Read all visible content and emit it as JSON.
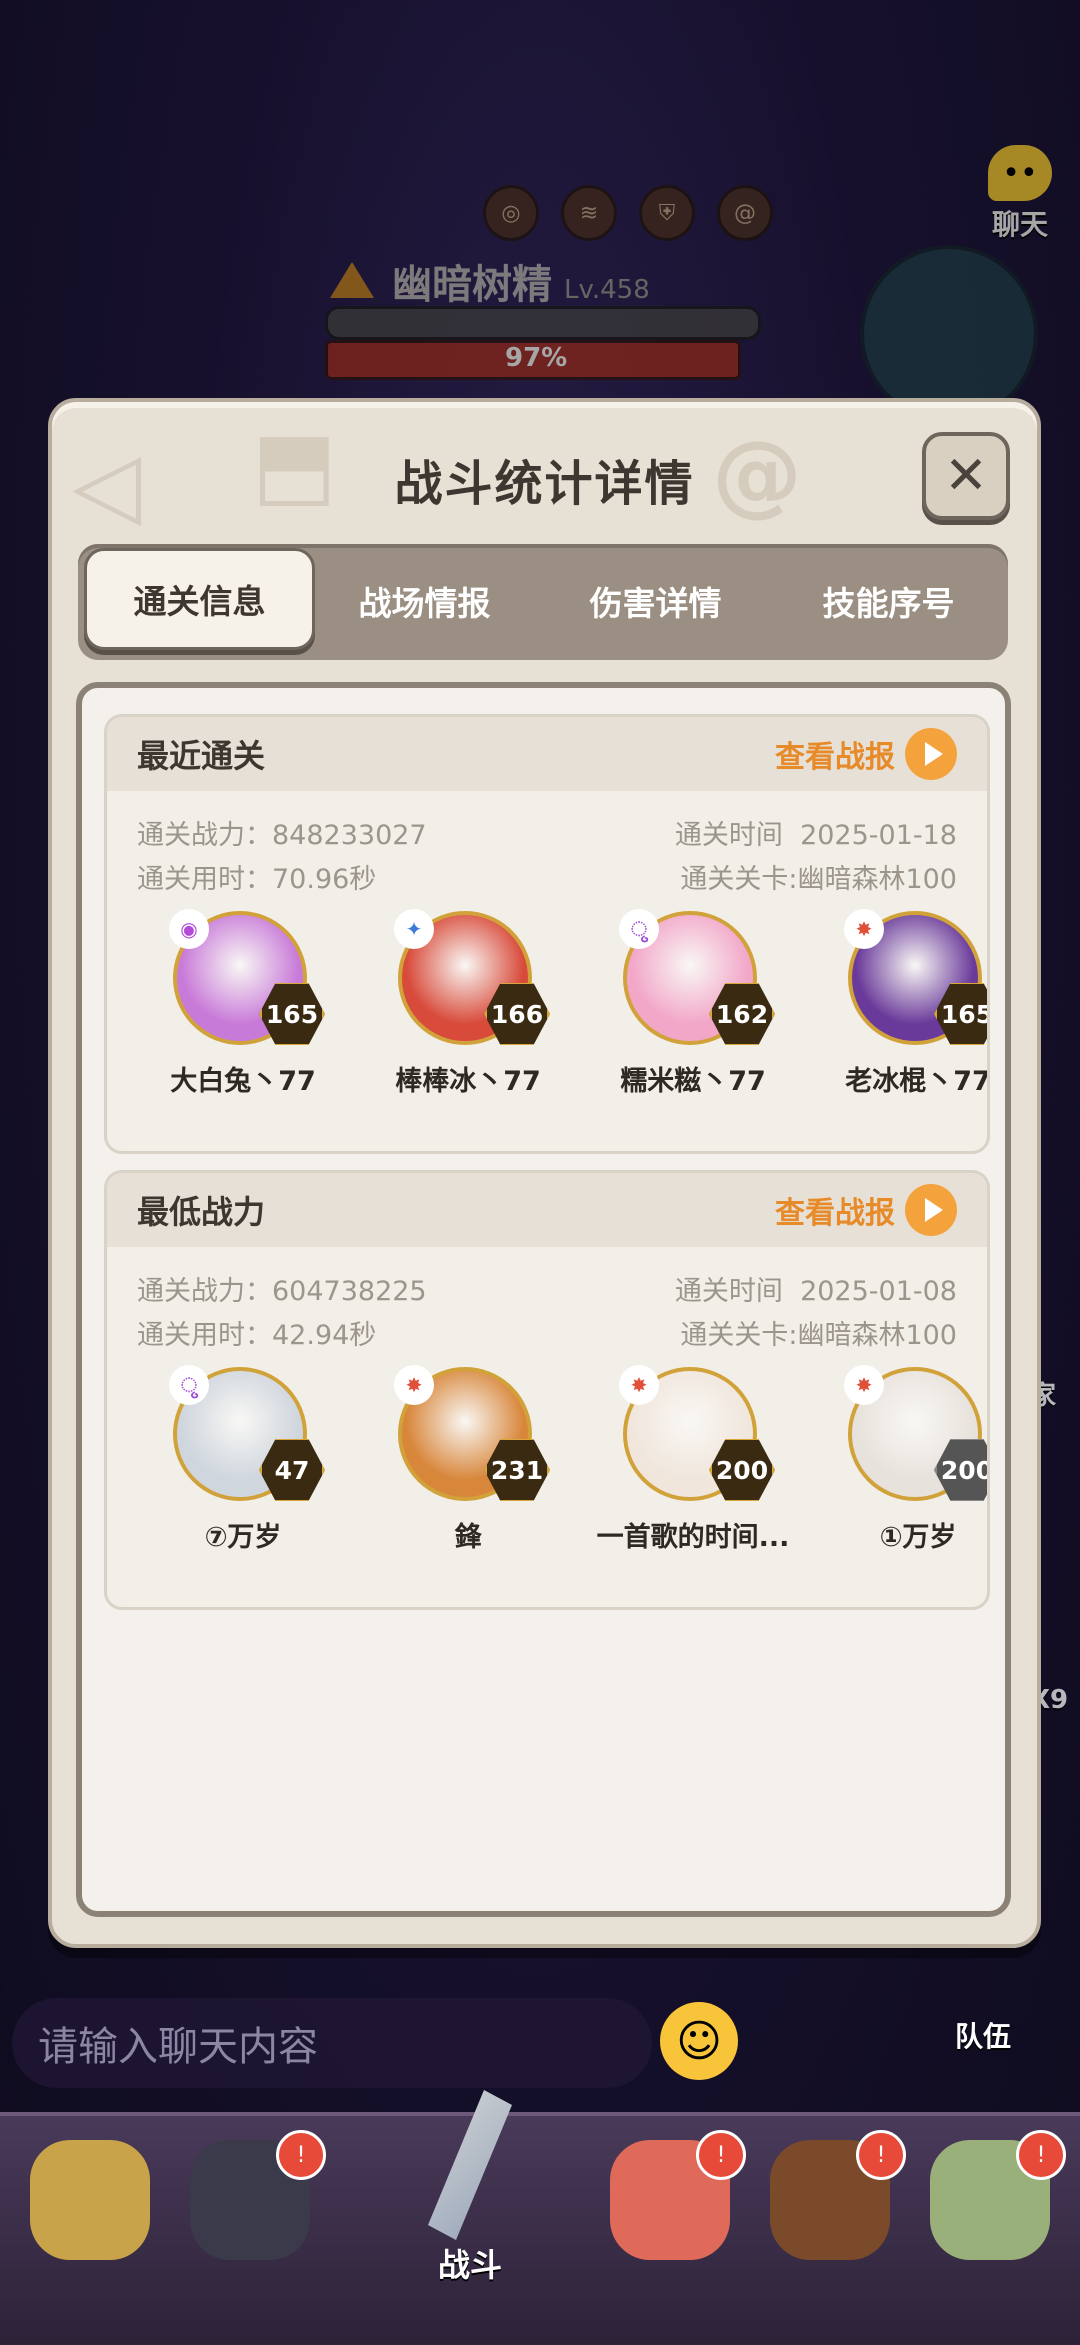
{
  "background": {
    "boss": {
      "name": "幽暗树精",
      "level": "Lv.458",
      "hp_percent": "97%"
    },
    "chat_float_label": "聊天",
    "chat_input_placeholder": "请输入聊天内容",
    "team_label": "队伍",
    "side_labels": [
      "家",
      "X9"
    ],
    "bottom_nav": {
      "battle_label": "战斗"
    }
  },
  "modal": {
    "title": "战斗统计详情",
    "close_icon": "close-icon",
    "tabs": [
      {
        "label": "通关信息",
        "active": true
      },
      {
        "label": "战场情报",
        "active": false
      },
      {
        "label": "伤害详情",
        "active": false
      },
      {
        "label": "技能序号",
        "active": false
      }
    ],
    "cards": [
      {
        "title": "最近通关",
        "view_report": "查看战报",
        "power_label": "通关战力：",
        "power": "848233027",
        "time_label": "通关时间",
        "time": "2025-01-18",
        "duration_label": "通关用时：",
        "duration": "70.96秒",
        "stage_label": "通关关卡:",
        "stage": "幽暗森林100",
        "heroes": [
          {
            "name": "大白兔丶77",
            "level": "165",
            "element": "dark",
            "color": "#c87ad8"
          },
          {
            "name": "棒棒冰丶77",
            "level": "166",
            "element": "water",
            "color": "#d84a3a"
          },
          {
            "name": "糯米糍丶77",
            "level": "162",
            "element": "wind",
            "color": "#f2a6c8"
          },
          {
            "name": "老冰棍丶77",
            "level": "165",
            "element": "fire",
            "color": "#6a3a9a"
          }
        ]
      },
      {
        "title": "最低战力",
        "view_report": "查看战报",
        "power_label": "通关战力：",
        "power": "604738225",
        "time_label": "通关时间",
        "time": "2025-01-08",
        "duration_label": "通关用时：",
        "duration": "42.94秒",
        "stage_label": "通关关卡:",
        "stage": "幽暗森林100",
        "heroes": [
          {
            "name": "⑦万岁",
            "level": "47",
            "element": "wind",
            "color": "#cfd6dd"
          },
          {
            "name": "鋒",
            "level": "231",
            "element": "fire",
            "color": "#d8863a"
          },
          {
            "name": "一首歌的时间...",
            "level": "200",
            "element": "fire",
            "color": "#f0e6dc"
          },
          {
            "name": "①万岁",
            "level": "200",
            "element": "fire",
            "color": "#e8e2dc"
          }
        ]
      }
    ]
  }
}
